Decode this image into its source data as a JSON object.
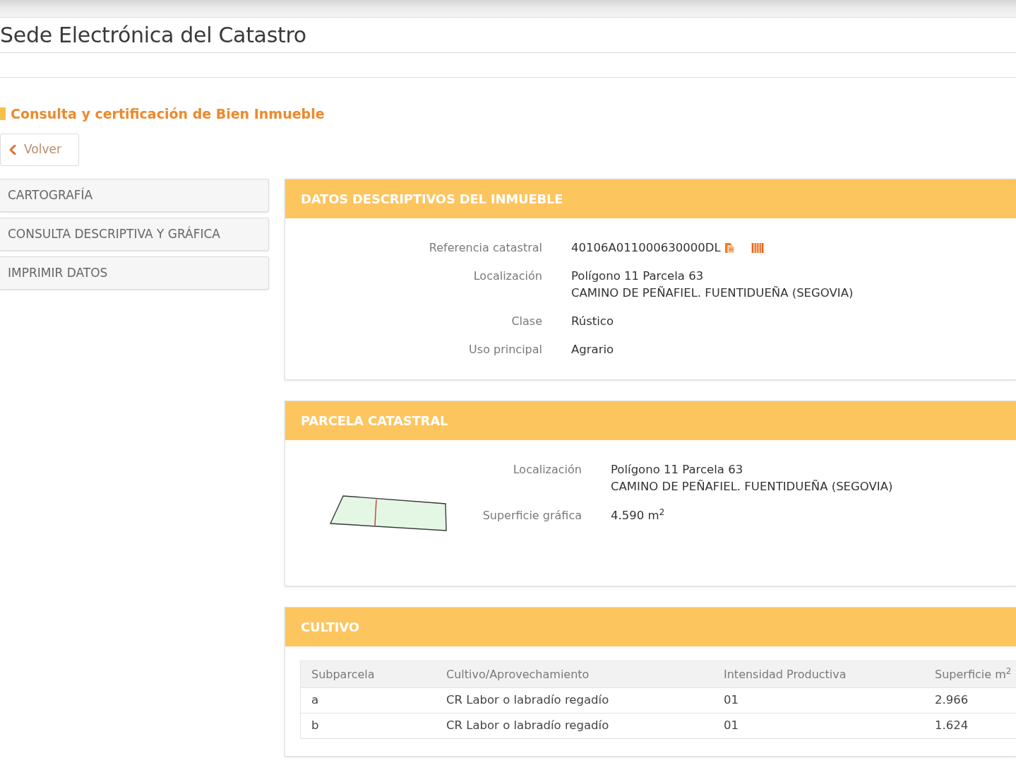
{
  "site": {
    "title": "Sede Electrónica del Catastro"
  },
  "page": {
    "heading": "Consulta y certificación de Bien Inmueble",
    "back_button": {
      "label": "Volver"
    }
  },
  "sidebar": {
    "items": [
      {
        "label": "CARTOGRAFÍA"
      },
      {
        "label": "CONSULTA DESCRIPTIVA Y GRÁFICA"
      },
      {
        "label": "IMPRIMIR DATOS"
      }
    ]
  },
  "panels": [
    {
      "kind": "details",
      "title": "DATOS DESCRIPTIVOS DEL INMUEBLE",
      "fields": [
        {
          "kind": "reference",
          "label": "Referencia catastral",
          "lines": [
            "40106A011000630000DL"
          ]
        },
        {
          "kind": "text",
          "label": "Localización",
          "lines": [
            "Polígono 11 Parcela 63",
            "CAMINO DE PEÑAFIEL. FUENTIDUEÑA (SEGOVIA)"
          ]
        },
        {
          "kind": "text",
          "label": "Clase",
          "lines": [
            "Rústico"
          ]
        },
        {
          "kind": "text",
          "label": "Uso principal",
          "lines": [
            "Agrario"
          ]
        }
      ]
    },
    {
      "kind": "parcel",
      "title": "PARCELA CATASTRAL",
      "fields": [
        {
          "kind": "text",
          "label": "Localización",
          "lines": [
            "Polígono 11 Parcela 63",
            "CAMINO DE PEÑAFIEL. FUENTIDUEÑA (SEGOVIA)"
          ]
        },
        {
          "kind": "text",
          "label": "Superficie gráfica",
          "lines": [
            "4.590 m$^{2}$"
          ]
        }
      ]
    },
    {
      "kind": "table",
      "title": "CULTIVO",
      "table": {
        "columns": [
          "Subparcela",
          "Cultivo/Aprovechamiento",
          "Intensidad Productiva",
          "Superficie m$^{2}$"
        ],
        "rows": [
          [
            "a",
            "CR Labor o labradío regadío",
            "01",
            "2.966"
          ],
          [
            "b",
            "CR Labor o labradío regadío",
            "01",
            "1.624"
          ]
        ]
      }
    }
  ]
}
